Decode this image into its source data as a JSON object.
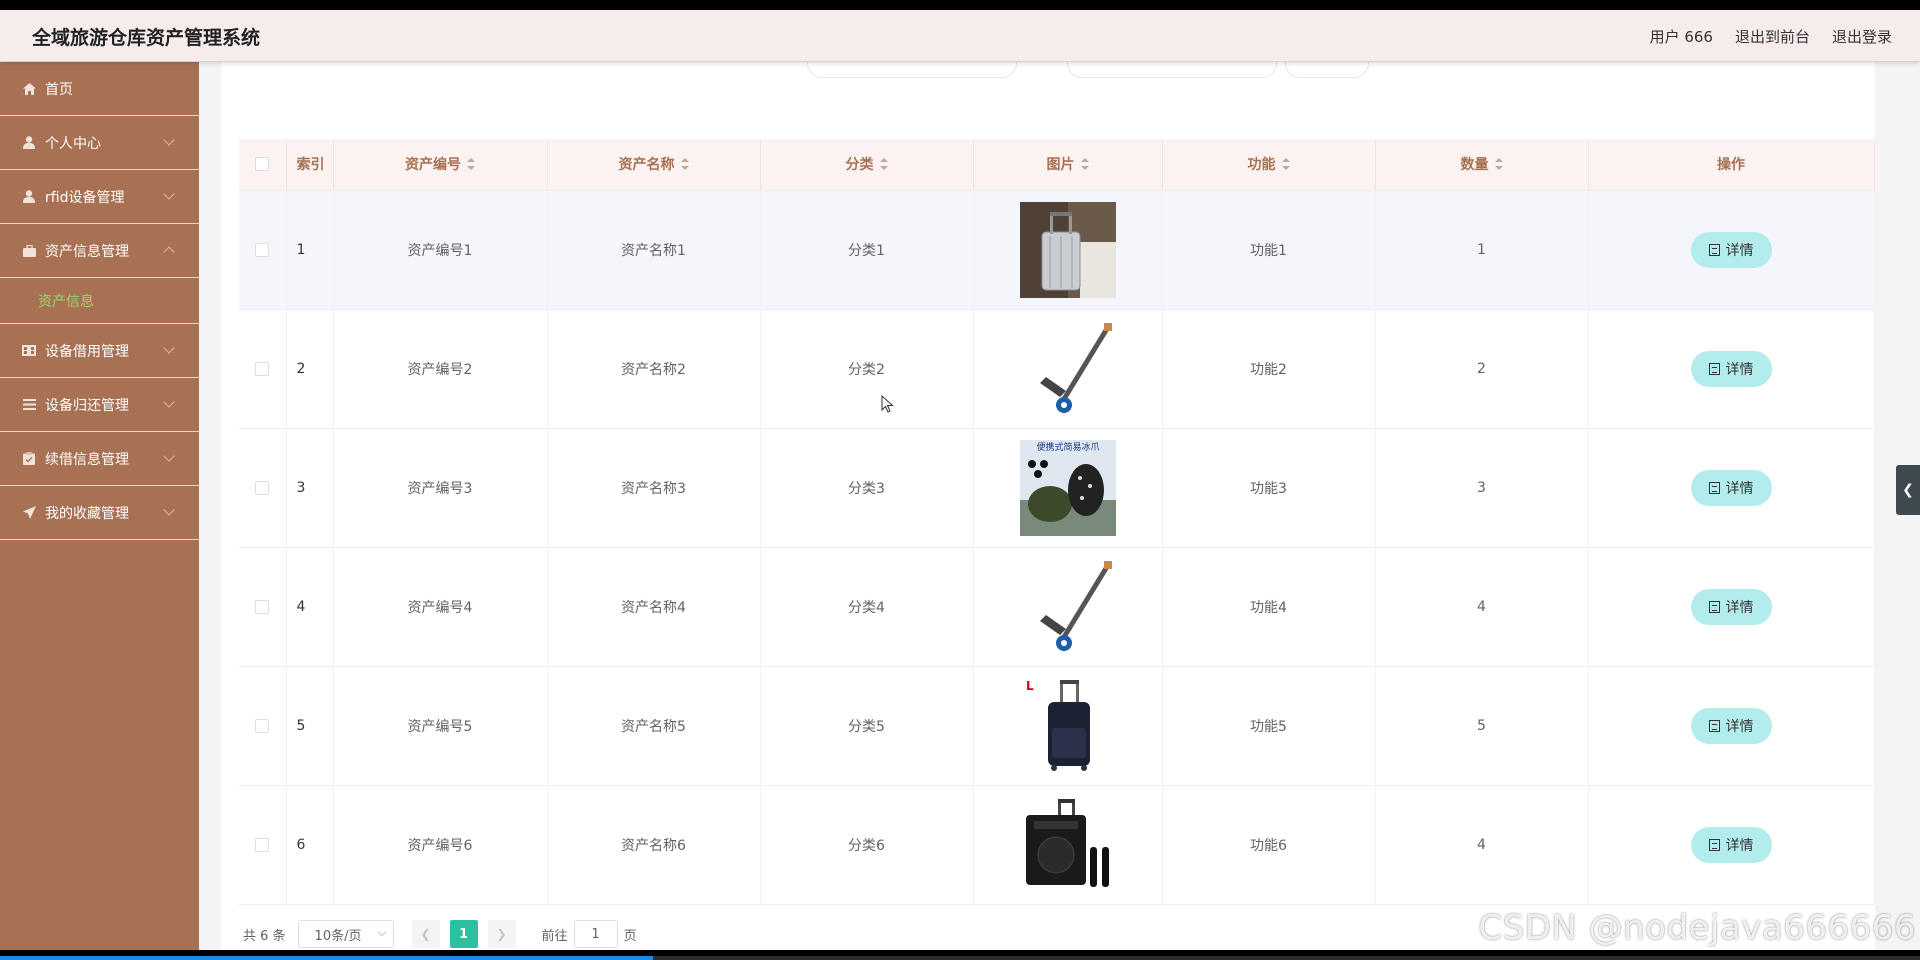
{
  "app": {
    "title": "全域旅游仓库资产管理系统"
  },
  "header": {
    "user": "用户 666",
    "front": "退出到前台",
    "logout": "退出登录"
  },
  "sidebar": {
    "items": [
      {
        "label": "首页",
        "icon": "home-icon",
        "expand": "none"
      },
      {
        "label": "个人中心",
        "icon": "user-icon",
        "expand": "down"
      },
      {
        "label": "rfid设备管理",
        "icon": "user-icon",
        "expand": "down"
      },
      {
        "label": "资产信息管理",
        "icon": "briefcase-icon",
        "expand": "up"
      },
      {
        "label": "设备借用管理",
        "icon": "film-icon",
        "expand": "down"
      },
      {
        "label": "设备归还管理",
        "icon": "list-icon",
        "expand": "down"
      },
      {
        "label": "续借信息管理",
        "icon": "clipboard-icon",
        "expand": "down"
      },
      {
        "label": "我的收藏管理",
        "icon": "send-icon",
        "expand": "down"
      }
    ],
    "sub_item": "资产信息"
  },
  "table": {
    "headers": {
      "index": "索引",
      "code": "资产编号",
      "name": "资产名称",
      "category": "分类",
      "image": "图片",
      "function": "功能",
      "quantity": "数量",
      "action": "操作"
    },
    "detail_label": "详情",
    "rows": [
      {
        "index": "1",
        "code": "资产编号1",
        "name": "资产名称1",
        "category": "分类1",
        "image": "suitcase",
        "function": "功能1",
        "quantity": "1"
      },
      {
        "index": "2",
        "code": "资产编号2",
        "name": "资产名称2",
        "category": "分类2",
        "image": "trolley",
        "function": "功能2",
        "quantity": "2"
      },
      {
        "index": "3",
        "code": "资产编号3",
        "name": "资产名称3",
        "category": "分类3",
        "image": "crampons",
        "function": "功能3",
        "quantity": "3"
      },
      {
        "index": "4",
        "code": "资产编号4",
        "name": "资产名称4",
        "category": "分类4",
        "image": "trolley",
        "function": "功能4",
        "quantity": "4"
      },
      {
        "index": "5",
        "code": "资产编号5",
        "name": "资产名称5",
        "category": "分类5",
        "image": "luggage",
        "function": "功能5",
        "quantity": "5"
      },
      {
        "index": "6",
        "code": "资产编号6",
        "name": "资产名称6",
        "category": "分类6",
        "image": "speaker",
        "function": "功能6",
        "quantity": "4"
      }
    ]
  },
  "image_texts": {
    "crampons": "便携式简易冰爪"
  },
  "pagination": {
    "total": "共 6 条",
    "page_size": "10条/页",
    "current": "1",
    "goto_label": "前往",
    "goto_value": "1",
    "page_suffix": "页"
  },
  "watermark": "CSDN @nodejava666666",
  "progress": 0.34,
  "colors": {
    "sidebar": "#a87154",
    "accent": "#2bc0a0",
    "detail_button": "#b3ecec",
    "header": "#f6ecec"
  }
}
